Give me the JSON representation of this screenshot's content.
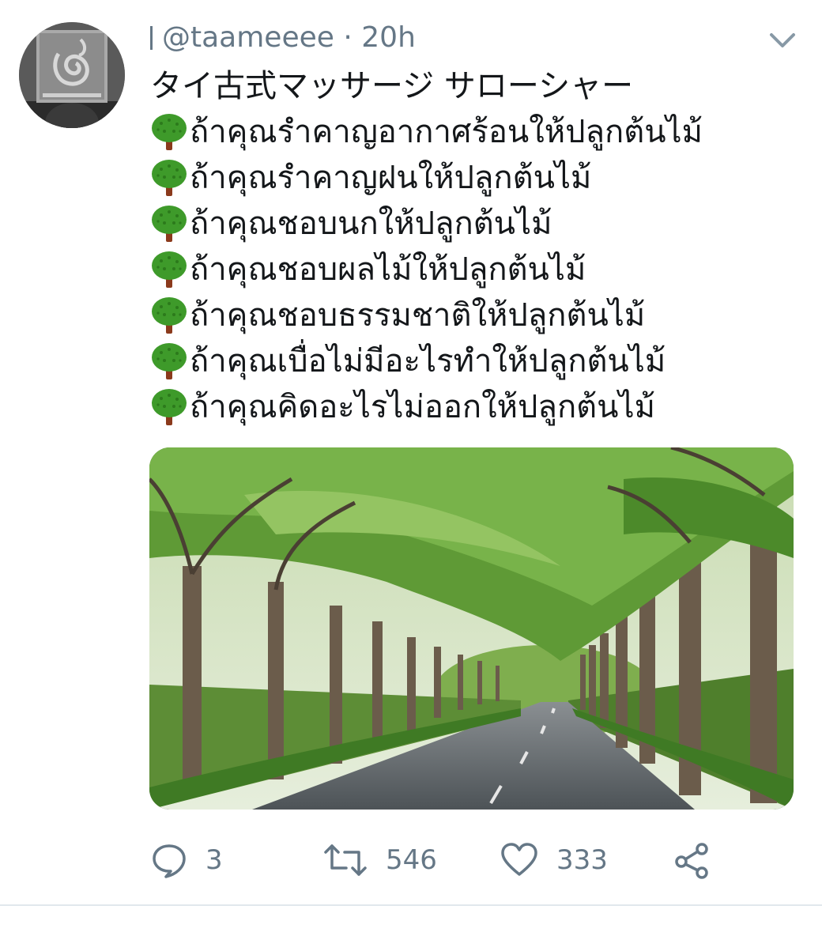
{
  "tweet": {
    "handle": "@taameeee",
    "separator": "·",
    "time": "20h",
    "title": "タイ古式マッサージ サローシャー",
    "lines": [
      "ถ้าคุณรำคาญอากาศร้อนให้ปลูกต้นไม้",
      "ถ้าคุณรำคาญฝนให้ปลูกต้นไม้",
      "ถ้าคุณชอบนกให้ปลูกต้นไม้",
      "ถ้าคุณชอบผลไม้ให้ปลูกต้นไม้",
      "ถ้าคุณชอบธรรมชาติให้ปลูกต้นไม้",
      "ถ้าคุณเบื่อไม่มีอะไรทำให้ปลูกต้นไม้",
      "ถ้าคุณคิดอะไรไม่ออกให้ปลูกต้นไม้"
    ],
    "line_icon": "deciduous-tree-emoji",
    "media": {
      "description_icon": "tree-tunnel-road-photo"
    }
  },
  "actions": {
    "reply": {
      "icon": "reply-icon",
      "count": "3"
    },
    "retweet": {
      "icon": "retweet-icon",
      "count": "546"
    },
    "like": {
      "icon": "heart-icon",
      "count": "333"
    },
    "share": {
      "icon": "share-icon"
    }
  },
  "colors": {
    "text": "#14171a",
    "secondary": "#657786",
    "divider": "#e1e8ed",
    "tree_green": "#3e9a2a",
    "trunk": "#8b3a1c"
  }
}
